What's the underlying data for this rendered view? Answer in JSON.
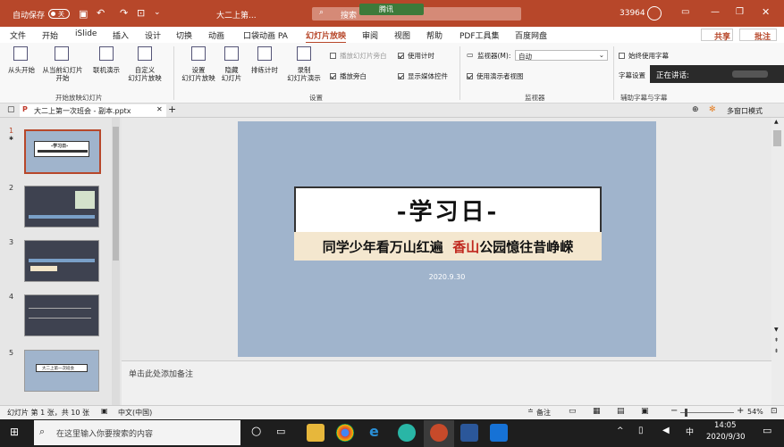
{
  "titlebar": {
    "autosave": "自动保存",
    "autosave_state": "关",
    "doc_short": "大二上第...",
    "search_placeholder": "搜索",
    "user_id": "33964",
    "meeting_badge": "腾讯"
  },
  "ribbon_tabs": [
    "文件",
    "开始",
    "iSlide",
    "插入",
    "设计",
    "切换",
    "动画",
    "口袋动画 PA",
    "幻灯片放映",
    "审阅",
    "视图",
    "帮助",
    "PDF工具集",
    "百度网盘"
  ],
  "share": {
    "share_label": "共享",
    "comment_label": "批注"
  },
  "ribbon": {
    "from_start": "从头开始",
    "from_current": "从当前幻灯片",
    "from_current2": "开始",
    "online": "联机演示",
    "custom": "自定义",
    "custom2": "幻灯片放映",
    "group1": "开始放映幻灯片",
    "setup": "设置",
    "setup2": "幻灯片放映",
    "hide": "隐藏",
    "hide2": "幻灯片",
    "rehearse": "排练计时",
    "record": "录制",
    "record2": "幻灯片演示",
    "opt_narration": "播放幻灯片旁白",
    "opt_timing": "使用计时",
    "opt_play": "播放旁白",
    "opt_media": "显示媒体控件",
    "group2": "设置",
    "monitor_label": "监视器(M):",
    "monitor_value": "自动",
    "presenter": "使用演示者视图",
    "group3": "监视器",
    "always_sub": "始终使用字幕",
    "sub_settings": "字幕设置",
    "group4": "辅助字幕与字幕"
  },
  "popup": {
    "speaking": "正在讲话:"
  },
  "doctab": {
    "filename": "大二上第一次班会 - 副本.pptx",
    "multiwindow": "多窗口模式"
  },
  "slides": [
    {
      "n": "1"
    },
    {
      "n": "2"
    },
    {
      "n": "3"
    },
    {
      "n": "4"
    },
    {
      "n": "5"
    }
  ],
  "thumbs": {
    "t1_title": "-学习日-",
    "t5_title": "大二上第一次班会"
  },
  "slide": {
    "title": "-学习日-",
    "subtitle_a": "同学少年看万山红遍",
    "subtitle_hl": "香山",
    "subtitle_b": "公园憶往昔峥嵘",
    "date": "2020.9.30"
  },
  "notes_placeholder": "单击此处添加备注",
  "status": {
    "slide_count": "幻灯片 第 1 张，共 10 张",
    "lang": "中文(中国)",
    "notes": "备注",
    "zoom": "54%"
  },
  "taskbar": {
    "search_placeholder": "在这里输入你要搜索的内容",
    "time": "14:05",
    "date": "2020/9/30"
  }
}
